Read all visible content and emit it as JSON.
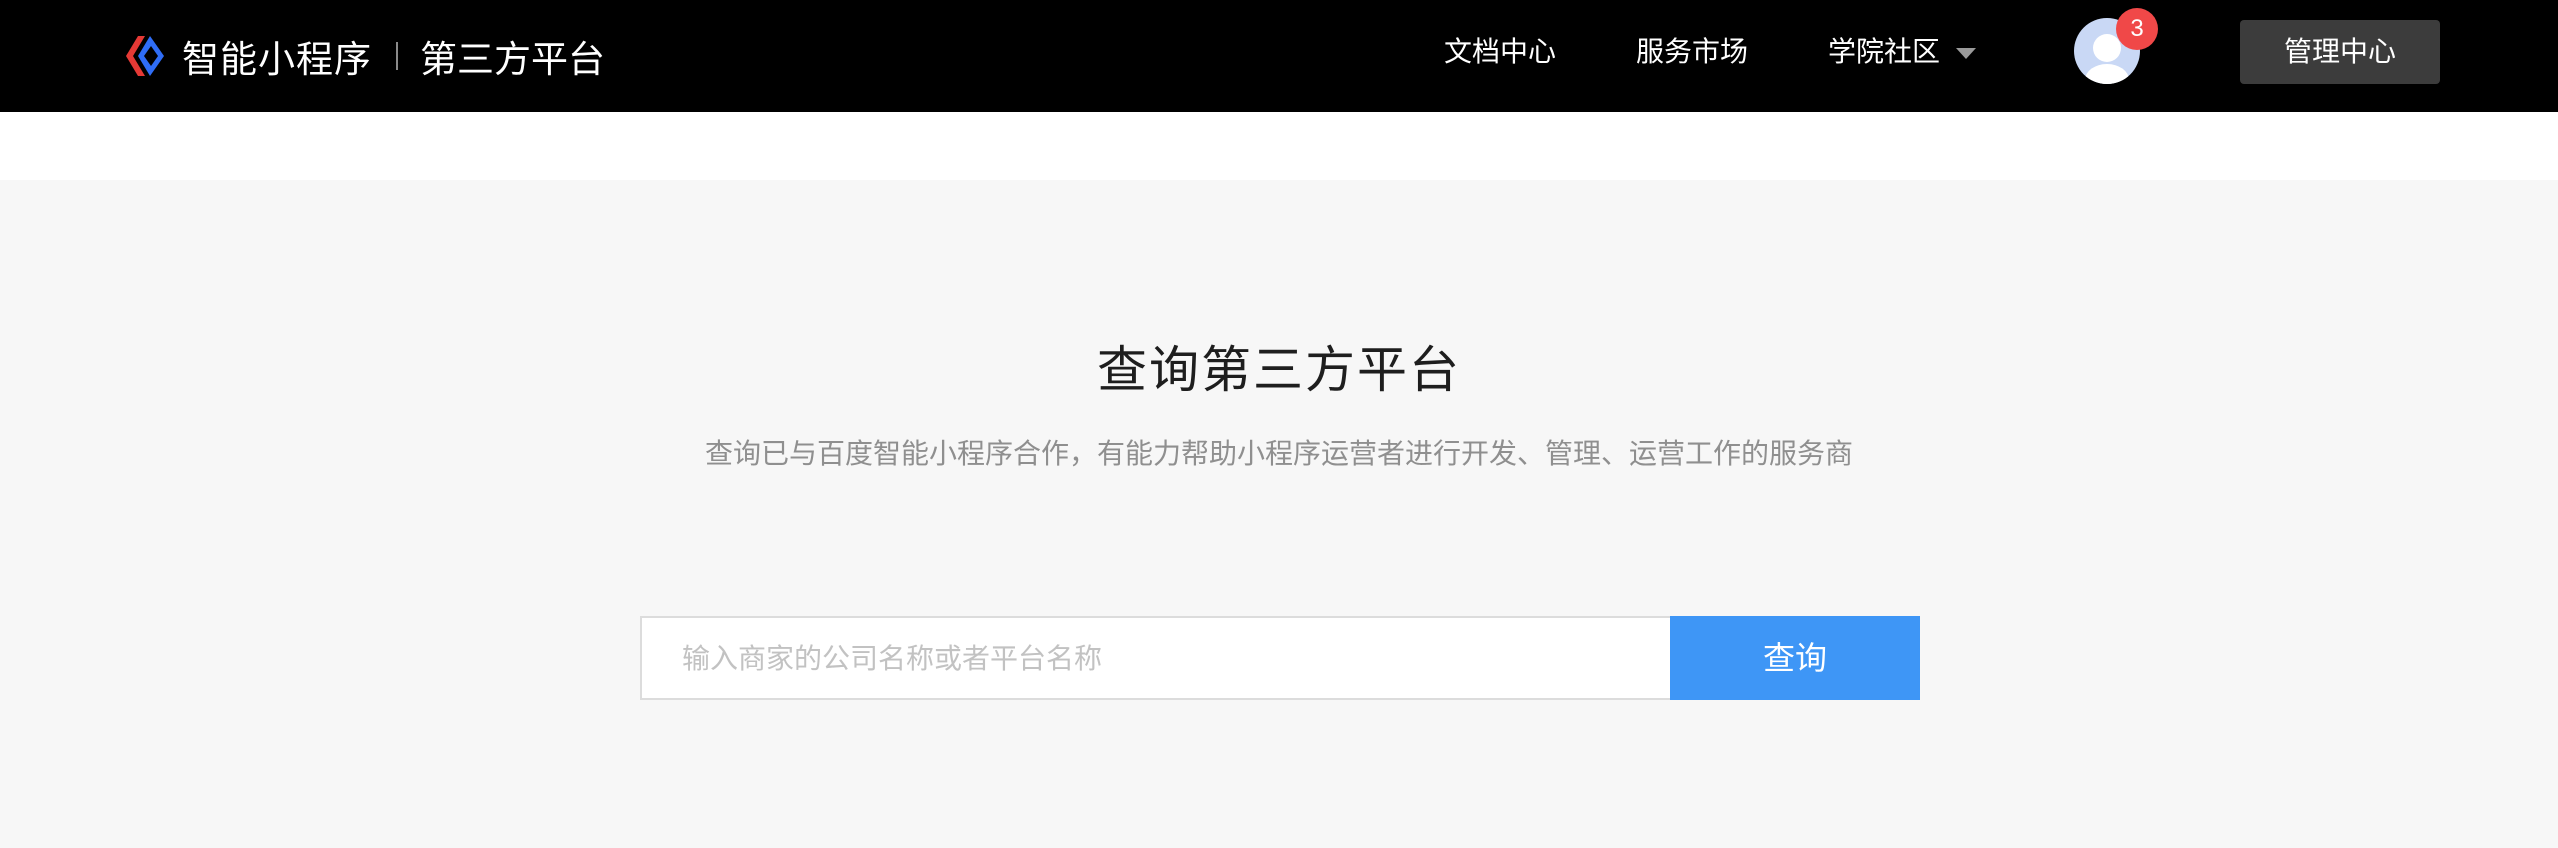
{
  "header": {
    "brand_name": "智能小程序",
    "brand_sub": "第三方平台",
    "logo_icon": "swan-logo-icon",
    "nav": {
      "docs": "文档中心",
      "market": "服务市场",
      "academy": "学院社区"
    },
    "notification_count": "3",
    "admin_button": "管理中心",
    "colors": {
      "background": "#000000",
      "logo_red": "#e53935",
      "logo_blue": "#2f6df6",
      "badge": "#f04848"
    }
  },
  "main": {
    "title": "查询第三方平台",
    "description": "查询已与百度智能小程序合作，有能力帮助小程序运营者进行开发、管理、运营工作的服务商",
    "search": {
      "placeholder": "输入商家的公司名称或者平台名称",
      "value": "",
      "button_label": "查询"
    },
    "colors": {
      "background": "#f7f7f7",
      "button": "#3e96f6"
    }
  }
}
